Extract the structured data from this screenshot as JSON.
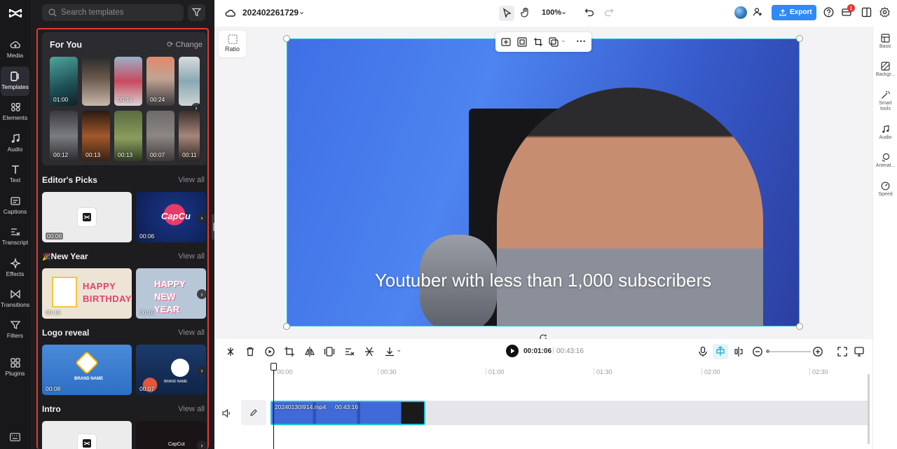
{
  "app": {
    "brand": "CapCut"
  },
  "rail": {
    "items": [
      {
        "label": "Media",
        "icon": "cloud-upload-icon"
      },
      {
        "label": "Templates",
        "icon": "templates-icon"
      },
      {
        "label": "Elements",
        "icon": "elements-icon"
      },
      {
        "label": "Audio",
        "icon": "music-note-icon"
      },
      {
        "label": "Text",
        "icon": "text-icon"
      },
      {
        "label": "Captions",
        "icon": "captions-icon"
      },
      {
        "label": "Transcript",
        "icon": "transcript-icon"
      },
      {
        "label": "Effects",
        "icon": "sparkle-icon"
      },
      {
        "label": "Transitions",
        "icon": "transitions-icon"
      },
      {
        "label": "Filters",
        "icon": "filters-icon"
      },
      {
        "label": "Plugins",
        "icon": "plugins-icon"
      }
    ],
    "active": "Templates"
  },
  "panel": {
    "search_placeholder": "Search templates",
    "for_you": {
      "title": "For You",
      "change_label": "Change",
      "row1": [
        "01:00",
        "",
        "00:14",
        "00:24",
        ""
      ],
      "row2": [
        "00:12",
        "00:13",
        "00:13",
        "00:07",
        "00:11"
      ]
    },
    "sections": [
      {
        "title": "Editor's Picks",
        "view_all": "View all",
        "durations": [
          "00:06",
          "00:06"
        ],
        "thumb_text": [
          "",
          "CapCu"
        ]
      },
      {
        "title": "New Year",
        "prefix": "🎉",
        "view_all": "View all",
        "durations": [
          "00:16",
          "00:16"
        ],
        "thumb_text": [
          "HAPPY BIRTHDAY",
          "HAPPY NEW YEAR"
        ]
      },
      {
        "title": "Logo reveal",
        "view_all": "View all",
        "durations": [
          "00:08",
          "00:07"
        ],
        "thumb_text": [
          "BRAND NAME",
          "BRAND NAME"
        ]
      },
      {
        "title": "Intro",
        "view_all": "View all",
        "durations": [
          "",
          ""
        ],
        "thumb_text": [
          "",
          "CapCut"
        ]
      }
    ]
  },
  "topbar": {
    "project_name": "202402261729",
    "zoom": "100%",
    "export_label": "Export",
    "notification_count": "1"
  },
  "canvas": {
    "ratio_label": "Ratio",
    "caption": "Youtuber with less than 1,000 subscribers"
  },
  "right_rail": [
    {
      "label": "Basic",
      "icon": "basic-icon"
    },
    {
      "label": "Backgr...",
      "icon": "background-icon"
    },
    {
      "label": "Smart tools",
      "icon": "magic-wand-icon"
    },
    {
      "label": "Audio",
      "icon": "music-note-icon"
    },
    {
      "label": "Animat...",
      "icon": "animation-icon"
    },
    {
      "label": "Speed",
      "icon": "speed-icon"
    }
  ],
  "timeline": {
    "current_time": "00:01:06",
    "total_time": "00:43:16",
    "ticks": [
      "00:00",
      "00:30",
      "01:00",
      "01:30",
      "02:00",
      "02:30"
    ],
    "clip_name": "20240130I914.mp4",
    "clip_duration": "00:43:16"
  },
  "colors": {
    "accent": "#2f8af5",
    "selection": "#20c5d8",
    "alert": "#e53935"
  }
}
